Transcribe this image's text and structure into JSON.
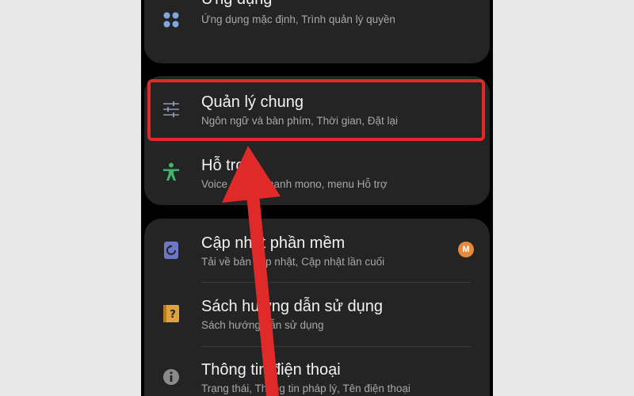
{
  "settings": {
    "apps": {
      "title": "Ứng dụng",
      "subtitle": "Ứng dụng mặc định, Trình quản lý quyền",
      "icon": "apps-grid-icon"
    },
    "general_management": {
      "title": "Quản lý chung",
      "subtitle": "Ngôn ngữ và bàn phím, Thời gian, Đặt lại",
      "icon": "sliders-icon"
    },
    "accessibility": {
      "title": "Hỗ trợ",
      "subtitle": "Voice A...Âm thanh mono, menu Hỗ trợ",
      "icon": "accessibility-person-icon"
    },
    "software_update": {
      "title": "Cập nhật phần mềm",
      "subtitle": "Tải về bản cập nhật, Cập nhật lần cuối",
      "icon": "update-icon",
      "badge": "M"
    },
    "user_manual": {
      "title": "Sách hướng dẫn sử dụng",
      "subtitle": "Sách hướng dẫn sử dụng",
      "icon": "manual-question-icon"
    },
    "about_phone": {
      "title": "Thông tin điện thoại",
      "subtitle": "Trạng thái, Thông tin pháp lý, Tên điện thoại",
      "icon": "info-icon"
    }
  },
  "colors": {
    "highlight": "#e02a2a",
    "arrow": "#e02a2a",
    "badge": "#e8883a"
  }
}
